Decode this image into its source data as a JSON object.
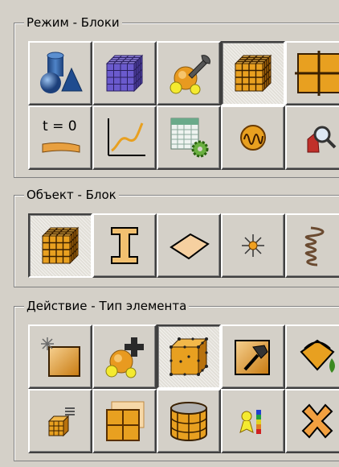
{
  "groups": {
    "mode": {
      "title": "Режим - Блоки"
    },
    "object": {
      "title": "Объект - Блок"
    },
    "action": {
      "title": "Действие - Тип элемента"
    }
  },
  "icons": {
    "t0_label": "t = 0"
  },
  "colors": {
    "panel": "#d4d0c8",
    "accent_orange": "#e8a020",
    "mesh_purple": "#6a5acd",
    "part_blue": "#2e5d9a"
  }
}
